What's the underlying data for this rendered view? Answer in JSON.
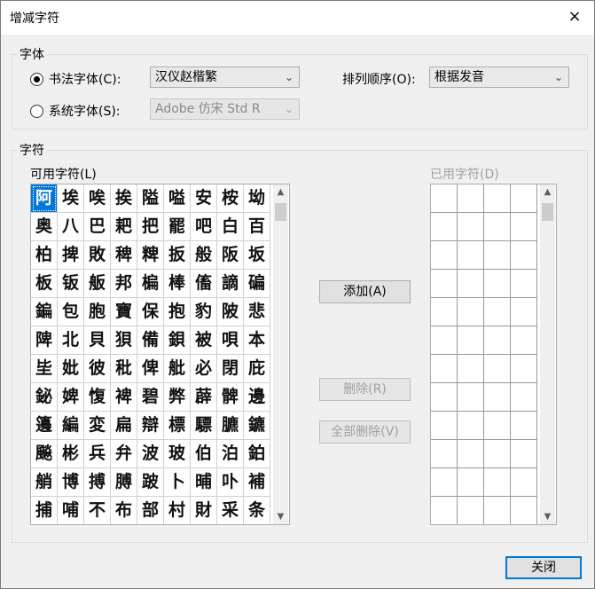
{
  "window": {
    "title": "增减字符"
  },
  "font_group": {
    "legend": "字体",
    "calligraphy_radio": "书法字体(C):",
    "calligraphy_value": "汉仪赵楷繁",
    "system_radio": "系统字体(S):",
    "system_value": "Adobe 仿宋 Std R",
    "sort_label": "排列顺序(O):",
    "sort_value": "根据发音"
  },
  "char_group": {
    "legend": "字符",
    "available_label": "可用字符(L)",
    "used_label": "已用字符(D)",
    "available_chars": [
      "阿",
      "埃",
      "唉",
      "挨",
      "隘",
      "嗌",
      "安",
      "桉",
      "坳",
      "奥",
      "八",
      "巴",
      "耙",
      "把",
      "罷",
      "吧",
      "白",
      "百",
      "柏",
      "捭",
      "敗",
      "稗",
      "粺",
      "扳",
      "般",
      "阪",
      "坂",
      "板",
      "钣",
      "舨",
      "邦",
      "楄",
      "棒",
      "傗",
      "謫",
      "碥",
      "鍽",
      "包",
      "胞",
      "寶",
      "保",
      "抱",
      "豹",
      "陂",
      "悲",
      "陴",
      "北",
      "貝",
      "狽",
      "備",
      "鋇",
      "被",
      "唄",
      "本",
      "坒",
      "妣",
      "彼",
      "秕",
      "俾",
      "舭",
      "必",
      "閉",
      "庇",
      "鉍",
      "婢",
      "愎",
      "裨",
      "碧",
      "弊",
      "薜",
      "髀",
      "邊",
      "籩",
      "編",
      "変",
      "扁",
      "辯",
      "標",
      "驃",
      "臕",
      "鑣",
      "飈",
      "彬",
      "兵",
      "弁",
      "波",
      "玻",
      "伯",
      "泊",
      "鉑",
      "艄",
      "博",
      "搏",
      "膊",
      "跛",
      "卜",
      "晡",
      "卟",
      "補",
      "捕",
      "哺",
      "不",
      "布",
      "部",
      "村",
      "財",
      "采",
      "条"
    ]
  },
  "buttons": {
    "add": "添加(A)",
    "remove": "删除(R)",
    "remove_all": "全部删除(V)",
    "close": "关闭"
  },
  "icons": {
    "close": "×",
    "chevron_down": "⌄",
    "scroll_up": "▲",
    "scroll_down": "▼"
  }
}
